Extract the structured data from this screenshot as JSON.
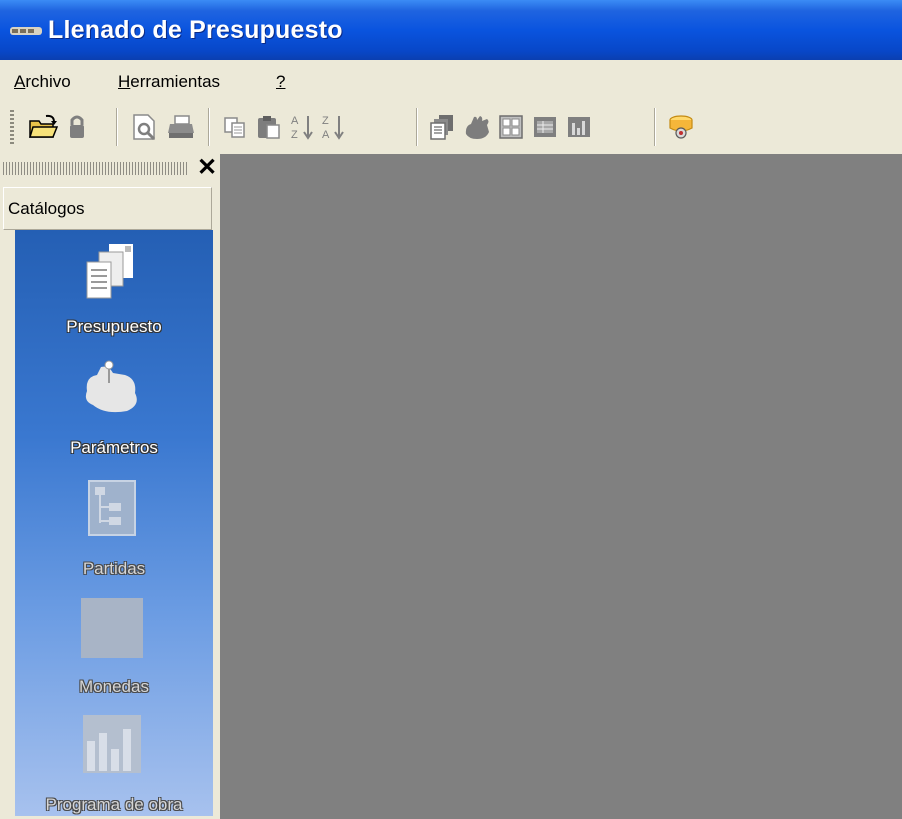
{
  "window": {
    "title": "Llenado de Presupuesto"
  },
  "menu": [
    {
      "label": "Archivo",
      "access_key": "A",
      "rest": "rchivo"
    },
    {
      "label": "Herramientas",
      "access_key": "H",
      "rest": "erramientas"
    },
    {
      "label": "?",
      "access_key": "?",
      "rest": ""
    }
  ],
  "toolbar": {
    "buttons": [
      "open-folder",
      "lock",
      "print-preview",
      "print",
      "copy",
      "paste",
      "sort-ascending",
      "sort-descending",
      "report",
      "hand-tool",
      "view-grid",
      "view-table",
      "chart",
      "database-settings"
    ]
  },
  "panel": {
    "close_glyph": "✕",
    "header": "Catálogos",
    "items": [
      {
        "label": "Presupuesto",
        "icon": "documents-icon",
        "enabled": true
      },
      {
        "label": "Parámetros",
        "icon": "map-pin-icon",
        "enabled": true
      },
      {
        "label": "Partidas",
        "icon": "tree-icon",
        "enabled": false
      },
      {
        "label": "Monedas",
        "icon": "coins-icon",
        "enabled": false
      },
      {
        "label": "Programa de obra",
        "icon": "schedule-chart-icon",
        "enabled": false
      }
    ]
  },
  "colors": {
    "title_bar": "#0a54df",
    "mdi_background": "#808080",
    "panel_gradient_top": "#245fb4",
    "panel_gradient_bottom": "#a8c2ee"
  }
}
